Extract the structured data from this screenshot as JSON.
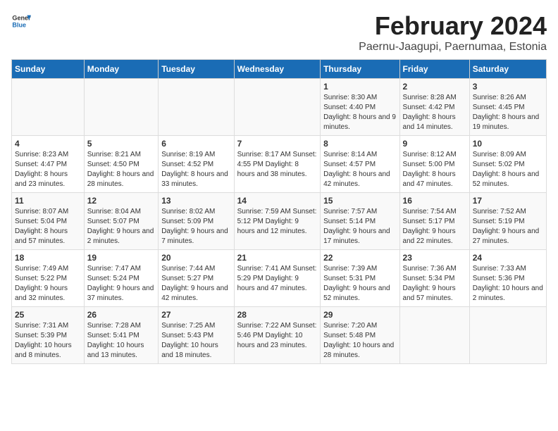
{
  "header": {
    "logo_line1": "General",
    "logo_line2": "Blue",
    "title": "February 2024",
    "subtitle": "Paernu-Jaagupi, Paernumaa, Estonia"
  },
  "days_of_week": [
    "Sunday",
    "Monday",
    "Tuesday",
    "Wednesday",
    "Thursday",
    "Friday",
    "Saturday"
  ],
  "weeks": [
    [
      {
        "day": "",
        "info": ""
      },
      {
        "day": "",
        "info": ""
      },
      {
        "day": "",
        "info": ""
      },
      {
        "day": "",
        "info": ""
      },
      {
        "day": "1",
        "info": "Sunrise: 8:30 AM\nSunset: 4:40 PM\nDaylight: 8 hours\nand 9 minutes."
      },
      {
        "day": "2",
        "info": "Sunrise: 8:28 AM\nSunset: 4:42 PM\nDaylight: 8 hours\nand 14 minutes."
      },
      {
        "day": "3",
        "info": "Sunrise: 8:26 AM\nSunset: 4:45 PM\nDaylight: 8 hours\nand 19 minutes."
      }
    ],
    [
      {
        "day": "4",
        "info": "Sunrise: 8:23 AM\nSunset: 4:47 PM\nDaylight: 8 hours\nand 23 minutes."
      },
      {
        "day": "5",
        "info": "Sunrise: 8:21 AM\nSunset: 4:50 PM\nDaylight: 8 hours\nand 28 minutes."
      },
      {
        "day": "6",
        "info": "Sunrise: 8:19 AM\nSunset: 4:52 PM\nDaylight: 8 hours\nand 33 minutes."
      },
      {
        "day": "7",
        "info": "Sunrise: 8:17 AM\nSunset: 4:55 PM\nDaylight: 8 hours\nand 38 minutes."
      },
      {
        "day": "8",
        "info": "Sunrise: 8:14 AM\nSunset: 4:57 PM\nDaylight: 8 hours\nand 42 minutes."
      },
      {
        "day": "9",
        "info": "Sunrise: 8:12 AM\nSunset: 5:00 PM\nDaylight: 8 hours\nand 47 minutes."
      },
      {
        "day": "10",
        "info": "Sunrise: 8:09 AM\nSunset: 5:02 PM\nDaylight: 8 hours\nand 52 minutes."
      }
    ],
    [
      {
        "day": "11",
        "info": "Sunrise: 8:07 AM\nSunset: 5:04 PM\nDaylight: 8 hours\nand 57 minutes."
      },
      {
        "day": "12",
        "info": "Sunrise: 8:04 AM\nSunset: 5:07 PM\nDaylight: 9 hours\nand 2 minutes."
      },
      {
        "day": "13",
        "info": "Sunrise: 8:02 AM\nSunset: 5:09 PM\nDaylight: 9 hours\nand 7 minutes."
      },
      {
        "day": "14",
        "info": "Sunrise: 7:59 AM\nSunset: 5:12 PM\nDaylight: 9 hours\nand 12 minutes."
      },
      {
        "day": "15",
        "info": "Sunrise: 7:57 AM\nSunset: 5:14 PM\nDaylight: 9 hours\nand 17 minutes."
      },
      {
        "day": "16",
        "info": "Sunrise: 7:54 AM\nSunset: 5:17 PM\nDaylight: 9 hours\nand 22 minutes."
      },
      {
        "day": "17",
        "info": "Sunrise: 7:52 AM\nSunset: 5:19 PM\nDaylight: 9 hours\nand 27 minutes."
      }
    ],
    [
      {
        "day": "18",
        "info": "Sunrise: 7:49 AM\nSunset: 5:22 PM\nDaylight: 9 hours\nand 32 minutes."
      },
      {
        "day": "19",
        "info": "Sunrise: 7:47 AM\nSunset: 5:24 PM\nDaylight: 9 hours\nand 37 minutes."
      },
      {
        "day": "20",
        "info": "Sunrise: 7:44 AM\nSunset: 5:27 PM\nDaylight: 9 hours\nand 42 minutes."
      },
      {
        "day": "21",
        "info": "Sunrise: 7:41 AM\nSunset: 5:29 PM\nDaylight: 9 hours\nand 47 minutes."
      },
      {
        "day": "22",
        "info": "Sunrise: 7:39 AM\nSunset: 5:31 PM\nDaylight: 9 hours\nand 52 minutes."
      },
      {
        "day": "23",
        "info": "Sunrise: 7:36 AM\nSunset: 5:34 PM\nDaylight: 9 hours\nand 57 minutes."
      },
      {
        "day": "24",
        "info": "Sunrise: 7:33 AM\nSunset: 5:36 PM\nDaylight: 10 hours\nand 2 minutes."
      }
    ],
    [
      {
        "day": "25",
        "info": "Sunrise: 7:31 AM\nSunset: 5:39 PM\nDaylight: 10 hours\nand 8 minutes."
      },
      {
        "day": "26",
        "info": "Sunrise: 7:28 AM\nSunset: 5:41 PM\nDaylight: 10 hours\nand 13 minutes."
      },
      {
        "day": "27",
        "info": "Sunrise: 7:25 AM\nSunset: 5:43 PM\nDaylight: 10 hours\nand 18 minutes."
      },
      {
        "day": "28",
        "info": "Sunrise: 7:22 AM\nSunset: 5:46 PM\nDaylight: 10 hours\nand 23 minutes."
      },
      {
        "day": "29",
        "info": "Sunrise: 7:20 AM\nSunset: 5:48 PM\nDaylight: 10 hours\nand 28 minutes."
      },
      {
        "day": "",
        "info": ""
      },
      {
        "day": "",
        "info": ""
      }
    ]
  ]
}
